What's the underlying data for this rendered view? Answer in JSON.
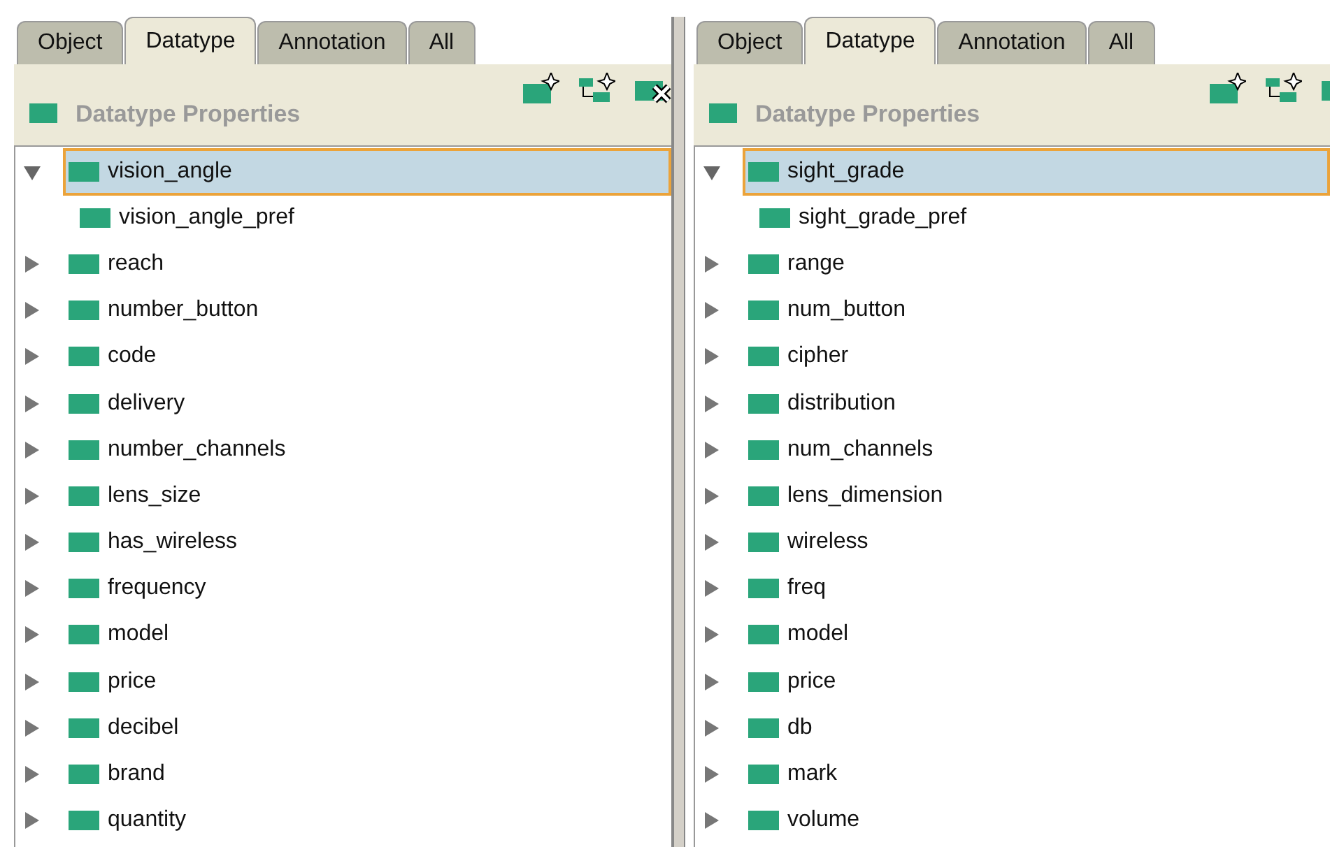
{
  "panels": [
    {
      "tabs": [
        {
          "label": "Object",
          "selected": false
        },
        {
          "label": "Datatype",
          "selected": true
        },
        {
          "label": "Annotation",
          "selected": false
        },
        {
          "label": "All",
          "selected": false
        }
      ],
      "header": "Datatype Properties",
      "tree": [
        {
          "label": "vision_angle",
          "expanded": true,
          "selected": true,
          "children": [
            {
              "label": "vision_angle_pref",
              "selected": false
            }
          ]
        },
        {
          "label": "reach",
          "expanded": false,
          "selected": false
        },
        {
          "label": "number_button",
          "expanded": false,
          "selected": false
        },
        {
          "label": "code",
          "expanded": false,
          "selected": false
        },
        {
          "label": "delivery",
          "expanded": false,
          "selected": false
        },
        {
          "label": "number_channels",
          "expanded": false,
          "selected": false
        },
        {
          "label": "lens_size",
          "expanded": false,
          "selected": false
        },
        {
          "label": "has_wireless",
          "expanded": false,
          "selected": false
        },
        {
          "label": "frequency",
          "expanded": false,
          "selected": false
        },
        {
          "label": "model",
          "expanded": false,
          "selected": false
        },
        {
          "label": "price",
          "expanded": false,
          "selected": false
        },
        {
          "label": "decibel",
          "expanded": false,
          "selected": false
        },
        {
          "label": "brand",
          "expanded": false,
          "selected": false
        },
        {
          "label": "quantity",
          "expanded": false,
          "selected": false
        }
      ]
    },
    {
      "tabs": [
        {
          "label": "Object",
          "selected": false
        },
        {
          "label": "Datatype",
          "selected": true
        },
        {
          "label": "Annotation",
          "selected": false
        },
        {
          "label": "All",
          "selected": false
        }
      ],
      "header": "Datatype Properties",
      "tree": [
        {
          "label": "sight_grade",
          "expanded": true,
          "selected": true,
          "children": [
            {
              "label": "sight_grade_pref",
              "selected": false
            }
          ]
        },
        {
          "label": "range",
          "expanded": false,
          "selected": false
        },
        {
          "label": "num_button",
          "expanded": false,
          "selected": false
        },
        {
          "label": "cipher",
          "expanded": false,
          "selected": false
        },
        {
          "label": "distribution",
          "expanded": false,
          "selected": false
        },
        {
          "label": "num_channels",
          "expanded": false,
          "selected": false
        },
        {
          "label": "lens_dimension",
          "expanded": false,
          "selected": false
        },
        {
          "label": "wireless",
          "expanded": false,
          "selected": false
        },
        {
          "label": "freq",
          "expanded": false,
          "selected": false
        },
        {
          "label": "model",
          "expanded": false,
          "selected": false
        },
        {
          "label": "price",
          "expanded": false,
          "selected": false
        },
        {
          "label": "db",
          "expanded": false,
          "selected": false
        },
        {
          "label": "mark",
          "expanded": false,
          "selected": false
        },
        {
          "label": "volume",
          "expanded": false,
          "selected": false
        }
      ]
    }
  ]
}
